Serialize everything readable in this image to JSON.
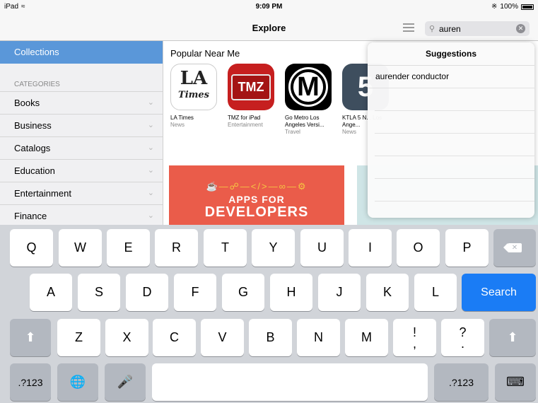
{
  "status": {
    "device": "iPad",
    "time": "9:09 PM",
    "battery": "100%"
  },
  "nav": {
    "title": "Explore"
  },
  "search": {
    "value": "auren",
    "icons": {
      "list": "list-icon",
      "search": "search-icon",
      "clear": "clear-icon"
    }
  },
  "sidebar": {
    "active": "Collections",
    "header": "CATEGORIES",
    "items": [
      {
        "label": "Books"
      },
      {
        "label": "Business"
      },
      {
        "label": "Catalogs"
      },
      {
        "label": "Education"
      },
      {
        "label": "Entertainment"
      },
      {
        "label": "Finance"
      }
    ]
  },
  "main": {
    "section_title": "Popular Near Me",
    "apps": [
      {
        "name": "LA Times",
        "category": "News",
        "icon_text": "LA",
        "icon_sub": "Times"
      },
      {
        "name": "TMZ for iPad",
        "category": "Entertainment",
        "icon_text": "TMZ"
      },
      {
        "name": "Go Metro Los Angeles Versi...",
        "category": "Travel",
        "icon_text": "M"
      },
      {
        "name": "KTLA 5 N... Los Ange...",
        "category": "News",
        "icon_text": "5"
      }
    ],
    "banner": {
      "line1": "APPS FOR",
      "line2": "DEVELOPERS"
    }
  },
  "suggestions": {
    "title": "Suggestions",
    "items": [
      "aurender conductor"
    ]
  },
  "keyboard": {
    "row1": [
      "Q",
      "W",
      "E",
      "R",
      "T",
      "Y",
      "U",
      "I",
      "O",
      "P"
    ],
    "row2": [
      "A",
      "S",
      "D",
      "F",
      "G",
      "H",
      "J",
      "K",
      "L"
    ],
    "row3": [
      "Z",
      "X",
      "C",
      "V",
      "B",
      "N",
      "M"
    ],
    "search_label": "Search",
    "numbers_label": ".?123",
    "punct1": [
      "!",
      ","
    ],
    "punct2": [
      "?",
      "."
    ]
  },
  "colors": {
    "accent": "#1a7cf5",
    "sidebar_active": "#5a97d9"
  }
}
